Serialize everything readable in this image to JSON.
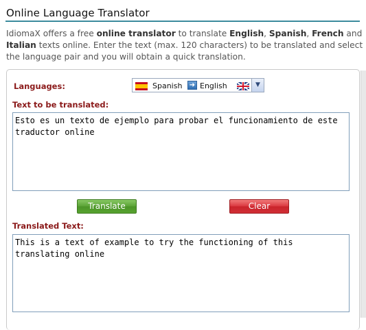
{
  "header": {
    "title": "Online Language Translator"
  },
  "intro": {
    "segments": [
      {
        "text": "IdiomaX offers a free ",
        "bold": false
      },
      {
        "text": "online translator",
        "bold": true
      },
      {
        "text": " to translate ",
        "bold": false
      },
      {
        "text": "English",
        "bold": true
      },
      {
        "text": ", ",
        "bold": false
      },
      {
        "text": "Spanish",
        "bold": true
      },
      {
        "text": ", ",
        "bold": false
      },
      {
        "text": "French",
        "bold": true
      },
      {
        "text": " and ",
        "bold": false
      },
      {
        "text": "Italian",
        "bold": true
      },
      {
        "text": " texts online. Enter the text (max. 120 characters) to be translated and select the language pair and you will obtain a quick translation.",
        "bold": false
      }
    ]
  },
  "form": {
    "languages_label": "Languages:",
    "language_pair": {
      "source": "Spanish",
      "target": "English",
      "source_flag": "spain-flag-icon",
      "target_flag": "uk-flag-icon"
    },
    "source_label": "Text to be translated:",
    "source_text": "Esto es un texto de ejemplo para probar el funcionamiento de este traductor online",
    "translate_button": "Translate",
    "clear_button": "Clear",
    "result_label": "Translated Text:",
    "result_text": "This is a text of example to try the functioning of this translating online"
  },
  "colors": {
    "label": "#8b1a1a",
    "title_rule": "#3a8a9c",
    "translate_button": "#5aa235",
    "clear_button": "#d9363e"
  }
}
